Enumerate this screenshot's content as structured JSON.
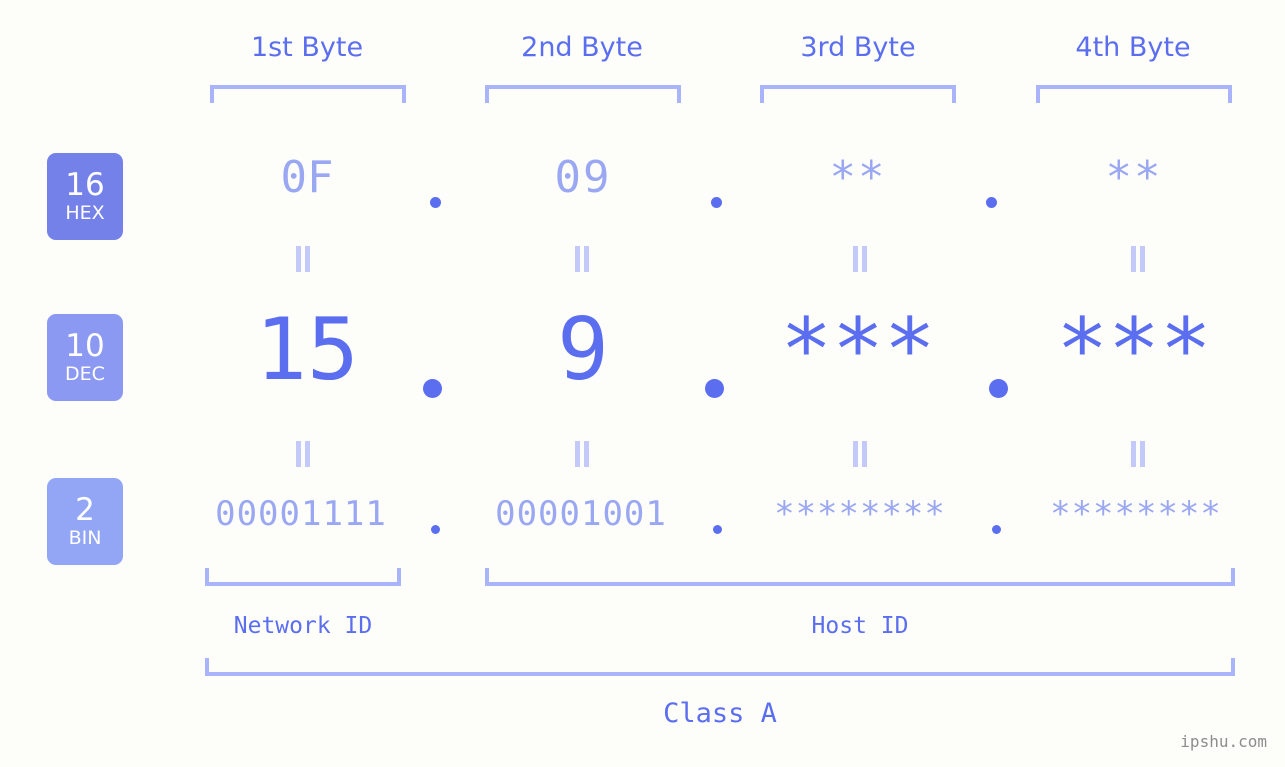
{
  "meta": {
    "watermark": "ipshu.com",
    "background_color": "#fdfefa",
    "accent_color": "#5b6ef0",
    "light_accent_color": "#9aa7f2",
    "bracket_color": "#aab4fb"
  },
  "byte_headers": [
    {
      "label": "1st Byte"
    },
    {
      "label": "2nd Byte"
    },
    {
      "label": "3rd Byte"
    },
    {
      "label": "4th Byte"
    }
  ],
  "bases": [
    {
      "id": "hex",
      "number": "16",
      "abbr": "HEX",
      "color": "#7481e8"
    },
    {
      "id": "dec",
      "number": "10",
      "abbr": "DEC",
      "color": "#8c99f2"
    },
    {
      "id": "bin",
      "number": "2",
      "abbr": "BIN",
      "color": "#93a6f5"
    }
  ],
  "rows": {
    "hex": {
      "values": [
        "0F",
        "09",
        "**",
        "**"
      ]
    },
    "dec": {
      "values": [
        "15",
        "9",
        "***",
        "***"
      ]
    },
    "bin": {
      "values": [
        "00001111",
        "00001001",
        "********",
        "********"
      ]
    }
  },
  "separators": {
    "dot": "."
  },
  "equals_marker": "=",
  "sections": [
    {
      "id": "network-id",
      "label": "Network ID"
    },
    {
      "id": "host-id",
      "label": "Host ID"
    }
  ],
  "class_label": "Class A",
  "chart_data": {
    "type": "table",
    "title": "IPv4 address byte breakdown",
    "columns": [
      "1st Byte",
      "2nd Byte",
      "3rd Byte",
      "4th Byte"
    ],
    "rows": [
      {
        "base": "16 HEX",
        "cells": [
          "0F",
          "09",
          "**",
          "**"
        ]
      },
      {
        "base": "10 DEC",
        "cells": [
          "15",
          "9",
          "***",
          "***"
        ]
      },
      {
        "base": "2 BIN",
        "cells": [
          "00001111",
          "00001001",
          "********",
          "********"
        ]
      }
    ],
    "annotations": {
      "network_id_bytes": [
        1
      ],
      "host_id_bytes": [
        2,
        3,
        4
      ],
      "class": "Class A"
    }
  }
}
